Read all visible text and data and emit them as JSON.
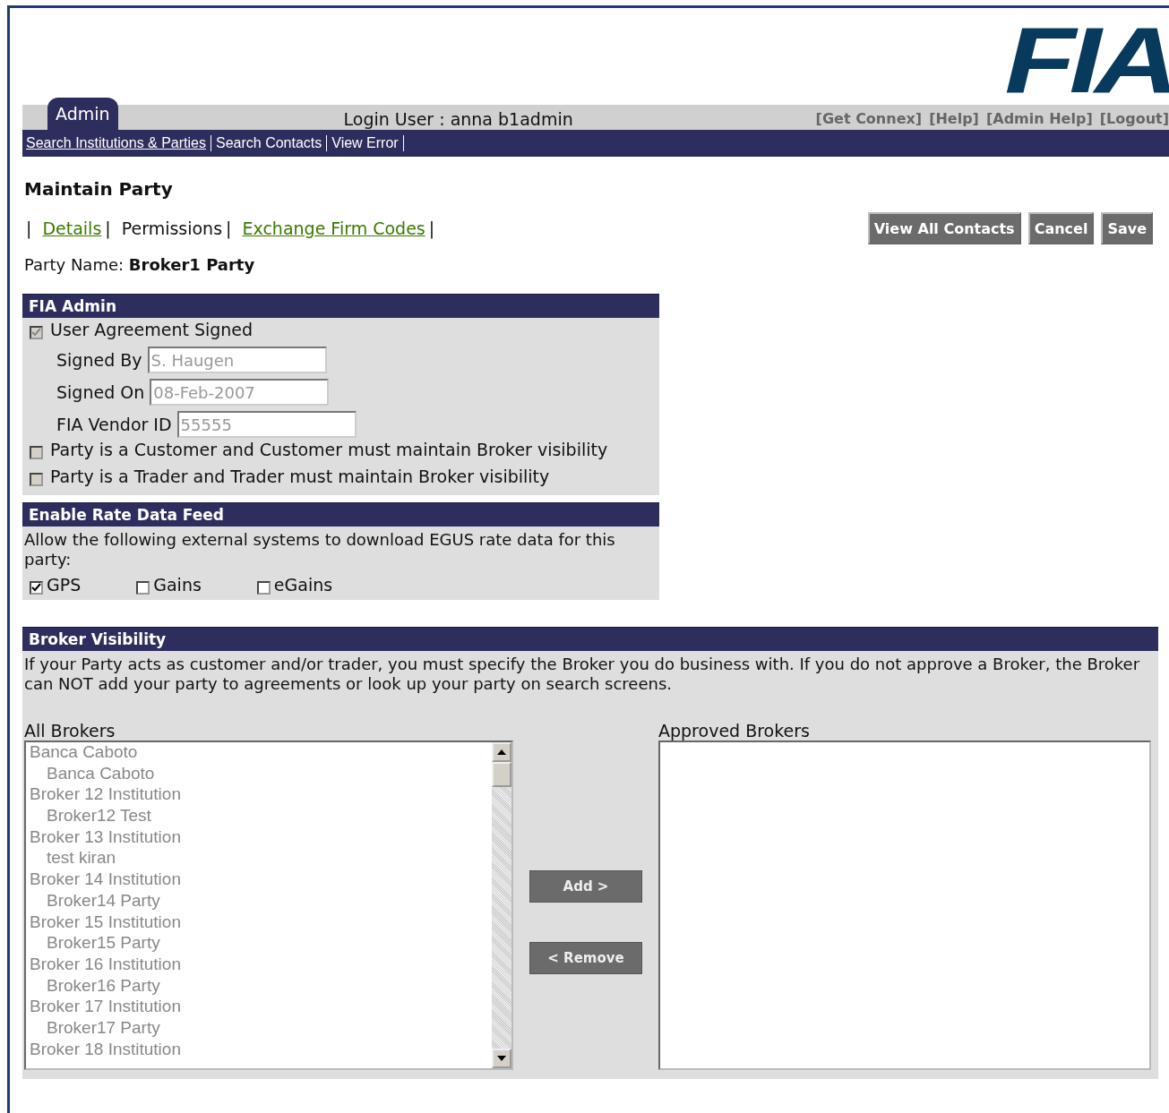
{
  "logo": "FIA",
  "top_bar": {
    "tab": {
      "label": "Admin",
      "selected": true
    },
    "login_user": "Login User : anna b1admin",
    "links": [
      "[Get Connex]",
      "[Help]",
      "[Admin Help]",
      "[Logout]"
    ]
  },
  "nav": [
    {
      "label": "Search Institutions & Parties",
      "selected": true
    },
    {
      "label": "Search Contacts",
      "selected": false
    },
    {
      "label": "View Error",
      "selected": false
    }
  ],
  "page_title": "Maintain Party",
  "sub_tab_separator": "|",
  "sub_tabs": [
    {
      "label": "Details",
      "selected": false
    },
    {
      "label": "Permissions",
      "selected": true
    },
    {
      "label": "Exchange Firm Codes",
      "selected": false
    }
  ],
  "actions": [
    "View All Contacts",
    "Cancel",
    "Save"
  ],
  "party_name": {
    "label": "Party Name:",
    "value": "Broker1 Party"
  },
  "fia_admin": {
    "title": "FIA Admin",
    "agreement": {
      "label": "User Agreement Signed",
      "checked": true,
      "disabled": true
    },
    "fields": [
      {
        "label": "Signed By",
        "value": "S. Haugen",
        "disabled": true
      },
      {
        "label": "Signed On",
        "value": "08-Feb-2007",
        "disabled": true
      },
      {
        "label": "FIA Vendor ID",
        "value": "55555",
        "disabled": true
      }
    ],
    "options": [
      {
        "label": "Party is a Customer and Customer must maintain Broker visibility",
        "checked": false,
        "disabled": true
      },
      {
        "label": "Party is a Trader and Trader must maintain Broker visibility",
        "checked": false,
        "disabled": true
      }
    ]
  },
  "rate_feed": {
    "title": "Enable Rate Data Feed",
    "text": "Allow the following external systems to download EGUS rate data for this party:",
    "systems": [
      {
        "label": "GPS",
        "checked": true
      },
      {
        "label": "Gains",
        "checked": false
      },
      {
        "label": "eGains",
        "checked": false
      }
    ]
  },
  "broker_visibility": {
    "title": "Broker Visibility",
    "text": "If your Party acts as customer and/or trader, you must specify the Broker you do business with. If you do not approve a Broker, the Broker can NOT add your party to agreements or look up your party on search screens.",
    "all_label": "All Brokers",
    "all_brokers": [
      {
        "label": "Banca Caboto",
        "children": [
          {
            "label": "Banca Caboto"
          }
        ]
      },
      {
        "label": "Broker 12 Institution",
        "children": [
          {
            "label": "Broker12 Test"
          }
        ]
      },
      {
        "label": "Broker 13 Institution",
        "children": [
          {
            "label": "test kiran"
          }
        ]
      },
      {
        "label": "Broker 14 Institution",
        "children": [
          {
            "label": "Broker14 Party"
          }
        ]
      },
      {
        "label": "Broker 15 Institution",
        "children": [
          {
            "label": "Broker15 Party"
          }
        ]
      },
      {
        "label": "Broker 16 Institution",
        "children": [
          {
            "label": "Broker16 Party"
          }
        ]
      },
      {
        "label": "Broker 17 Institution",
        "children": [
          {
            "label": "Broker17 Party"
          }
        ]
      },
      {
        "label": "Broker 18 Institution"
      }
    ],
    "buttons": [
      "Add >",
      "< Remove"
    ],
    "approved_label": "Approved Brokers"
  }
}
